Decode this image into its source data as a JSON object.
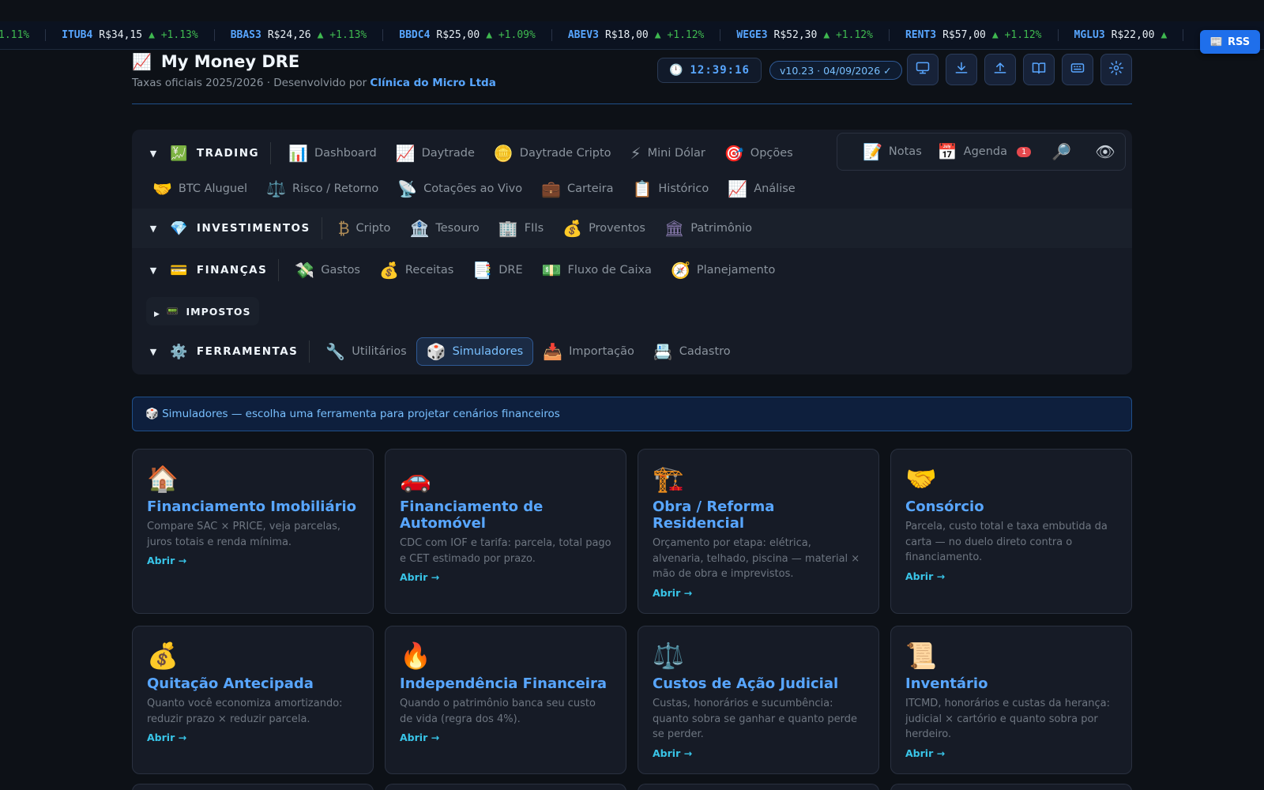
{
  "ticker": [
    {
      "sym": "",
      "price": "",
      "chg": "1.11%"
    },
    {
      "sym": "ITUB4",
      "price": "R$34,15",
      "chg": "▲ +1.13%"
    },
    {
      "sym": "BBAS3",
      "price": "R$24,26",
      "chg": "▲ +1.13%"
    },
    {
      "sym": "BBDC4",
      "price": "R$25,00",
      "chg": "▲ +1.09%"
    },
    {
      "sym": "ABEV3",
      "price": "R$18,00",
      "chg": "▲ +1.12%"
    },
    {
      "sym": "WEGE3",
      "price": "R$52,30",
      "chg": "▲ +1.12%"
    },
    {
      "sym": "RENT3",
      "price": "R$57,00",
      "chg": "▲ +1.12%"
    },
    {
      "sym": "MGLU3",
      "price": "R$22,00",
      "chg": "▲"
    }
  ],
  "rss": {
    "icon": "📰",
    "label": "RSS"
  },
  "header": {
    "logo": "📈",
    "title": "My Money DRE",
    "subtitle_prefix": "Taxas oficiais 2025/2026 · Desenvolvido por ",
    "subtitle_company": "Clínica do Micro Ltda",
    "clock_icon": "🕛",
    "clock": "12:39:16",
    "version": "v10.23 · 04/09/2026 ✓",
    "buttons": [
      "monitor-icon",
      "download-icon",
      "upload-icon",
      "book-icon",
      "keyboard-icon",
      "gear-icon"
    ]
  },
  "nav": {
    "trading": {
      "label": "TRADING",
      "icon": "💹",
      "row1": [
        {
          "icon": "📊",
          "label": "Dashboard"
        },
        {
          "icon": "📈",
          "label": "Daytrade"
        },
        {
          "icon": "🪙",
          "label": "Daytrade Cripto"
        },
        {
          "icon": "⚡",
          "label": "Mini Dólar"
        },
        {
          "icon": "🎯",
          "label": "Opções"
        }
      ],
      "row2": [
        {
          "icon": "🤝",
          "label": "BTC Aluguel"
        },
        {
          "icon": "⚖️",
          "label": "Risco / Retorno"
        },
        {
          "icon": "📡",
          "label": "Cotações ao Vivo"
        },
        {
          "icon": "💼",
          "label": "Carteira"
        },
        {
          "icon": "📋",
          "label": "Histórico"
        },
        {
          "icon": "📈",
          "label": "Análise"
        }
      ]
    },
    "quick": {
      "notes": {
        "icon": "📝",
        "label": "Notas"
      },
      "agenda": {
        "icon": "📅",
        "label": "Agenda",
        "badge": "1"
      },
      "search_icon": "🔎",
      "eye_icon": "👁"
    },
    "investimentos": {
      "label": "INVESTIMENTOS",
      "icon": "💎",
      "items": [
        {
          "icon": "₿",
          "label": "Cripto"
        },
        {
          "icon": "🏦",
          "label": "Tesouro"
        },
        {
          "icon": "🏢",
          "label": "FIIs"
        },
        {
          "icon": "💰",
          "label": "Proventos"
        },
        {
          "icon": "🏛",
          "label": "Patrimônio"
        }
      ]
    },
    "financas": {
      "label": "FINANÇAS",
      "icon": "💳",
      "items": [
        {
          "icon": "💸",
          "label": "Gastos"
        },
        {
          "icon": "💰",
          "label": "Receitas"
        },
        {
          "icon": "📑",
          "label": "DRE"
        },
        {
          "icon": "💵",
          "label": "Fluxo de Caixa"
        },
        {
          "icon": "🧭",
          "label": "Planejamento"
        }
      ]
    },
    "impostos": {
      "label": "IMPOSTOS",
      "icon": "📟"
    },
    "ferramentas": {
      "label": "FERRAMENTAS",
      "icon": "⚙️",
      "items": [
        {
          "icon": "🔧",
          "label": "Utilitários"
        },
        {
          "icon": "🎲",
          "label": "Simuladores"
        },
        {
          "icon": "📥",
          "label": "Importação"
        },
        {
          "icon": "📇",
          "label": "Cadastro"
        }
      ]
    }
  },
  "banner": "🎲 Simuladores — escolha uma ferramenta para projetar cenários financeiros",
  "open_label": "Abrir →",
  "cards": [
    {
      "icon": "🏠",
      "title": "Financiamento Imobiliário",
      "desc": "Compare SAC × PRICE, veja parcelas, juros totais e renda mínima."
    },
    {
      "icon": "🚗",
      "title": "Financiamento de Automóvel",
      "desc": "CDC com IOF e tarifa: parcela, total pago e CET estimado por prazo."
    },
    {
      "icon": "🏗️",
      "title": "Obra / Reforma Residencial",
      "desc": "Orçamento por etapa: elétrica, alvenaria, telhado, piscina — material × mão de obra e imprevistos."
    },
    {
      "icon": "🤝",
      "title": "Consórcio",
      "desc": "Parcela, custo total e taxa embutida da carta — no duelo direto contra o financiamento."
    },
    {
      "icon": "💰",
      "title": "Quitação Antecipada",
      "desc": "Quanto você economiza amortizando: reduzir prazo × reduzir parcela."
    },
    {
      "icon": "🔥",
      "title": "Independência Financeira",
      "desc": "Quando o patrimônio banca seu custo de vida (regra dos 4%)."
    },
    {
      "icon": "⚖️",
      "title": "Custos de Ação Judicial",
      "desc": "Custas, honorários e sucumbência: quanto sobra se ganhar e quanto perde se perder."
    },
    {
      "icon": "📜",
      "title": "Inventário",
      "desc": "ITCMD, honorários e custas da herança: judicial × cartório e quanto sobra por herdeiro."
    }
  ]
}
